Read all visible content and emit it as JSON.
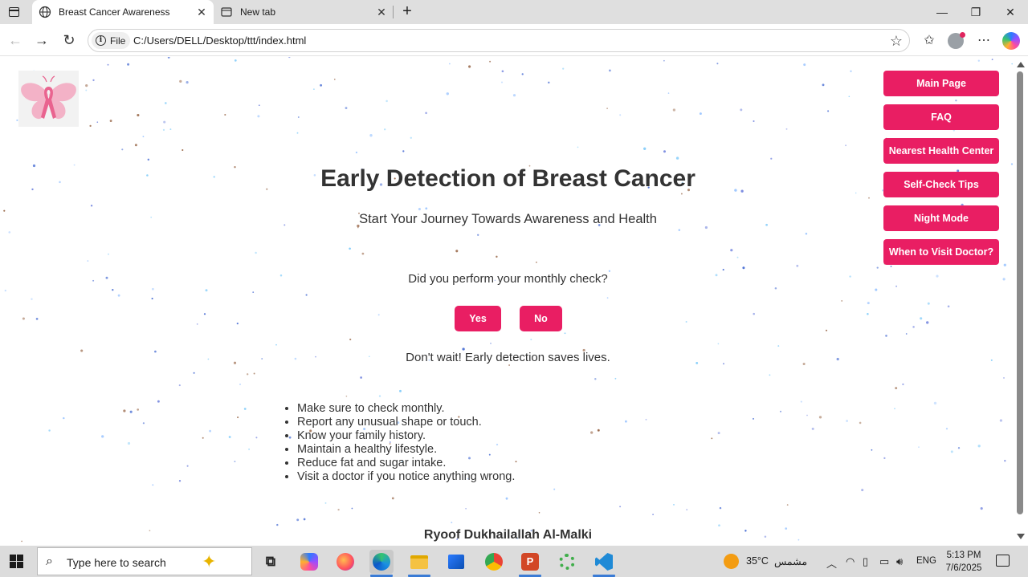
{
  "browser": {
    "tabs": [
      {
        "title": "Breast Cancer Awareness",
        "active": true
      },
      {
        "title": "New tab",
        "active": false
      }
    ],
    "address": {
      "chip_label": "File",
      "url": "C:/Users/DELL/Desktop/ttt/index.html"
    }
  },
  "page": {
    "nav_menu": [
      "Main Page",
      "FAQ",
      "Nearest Health Center",
      "Self-Check Tips",
      "Night Mode",
      "When to Visit Doctor?"
    ],
    "title": "Early Detection of Breast Cancer",
    "subtitle": "Start Your Journey Towards Awareness and Health",
    "question": "Did you perform your monthly check?",
    "yes_label": "Yes",
    "no_label": "No",
    "message": "Don't wait! Early detection saves lives.",
    "tips": [
      "Make sure to check monthly.",
      "Report any unusual shape or touch.",
      "Know your family history.",
      "Maintain a healthy lifestyle.",
      "Reduce fat and sugar intake.",
      "Visit a doctor if you notice anything wrong."
    ],
    "author": "Ryoof Dukhailallah Al-Malki",
    "accent_color": "#e91e63"
  },
  "taskbar": {
    "search_placeholder": "Type here to search",
    "weather_temp": "35°C",
    "weather_text": "مشمس",
    "language": "ENG",
    "time": "5:13 PM",
    "date": "7/6/2025"
  }
}
